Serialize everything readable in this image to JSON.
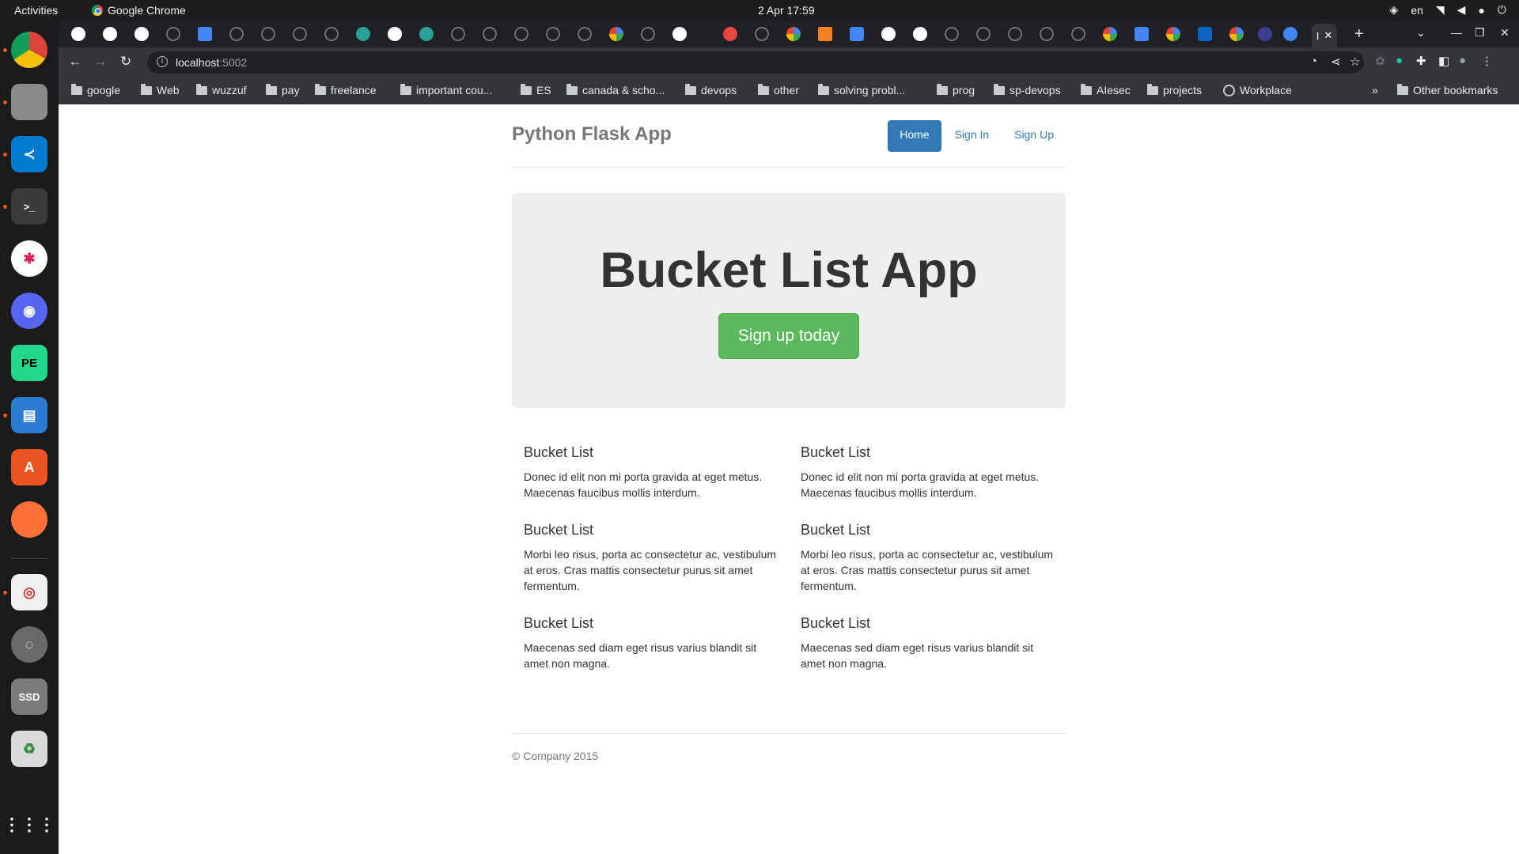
{
  "topbar": {
    "activities": "Activities",
    "app_name": "Google Chrome",
    "clock": "2 Apr  17:59",
    "lang": "en"
  },
  "browser": {
    "active_tab_label": "I",
    "url_host": "localhost",
    "url_port": ":5002"
  },
  "bookmarks": {
    "items": [
      "google",
      "Web",
      "wuzzuf",
      "pay",
      "freelance",
      "important cou...",
      "ES",
      "canada & scho...",
      "devops",
      "other",
      "solving probl...",
      "prog",
      "sp-devops",
      "AIesec",
      "projects",
      "Workplace"
    ],
    "overflow": "»",
    "other": "Other bookmarks"
  },
  "site": {
    "brand": "Python Flask App",
    "nav": [
      "Home",
      "Sign In",
      "Sign Up"
    ]
  },
  "hero": {
    "title": "Bucket List App",
    "button": "Sign up today"
  },
  "marketing": {
    "left": [
      {
        "heading": "Bucket List",
        "text": "Donec id elit non mi porta gravida at eget metus. Maecenas faucibus mollis interdum."
      },
      {
        "heading": "Bucket List",
        "text": "Morbi leo risus, porta ac consectetur ac, vestibulum at eros. Cras mattis consectetur purus sit amet fermentum."
      },
      {
        "heading": "Bucket List",
        "text": "Maecenas sed diam eget risus varius blandit sit amet non magna."
      }
    ],
    "right": [
      {
        "heading": "Bucket List",
        "text": "Donec id elit non mi porta gravida at eget metus. Maecenas faucibus mollis interdum."
      },
      {
        "heading": "Bucket List",
        "text": "Morbi leo risus, porta ac consectetur ac, vestibulum at eros. Cras mattis consectetur purus sit amet fermentum."
      },
      {
        "heading": "Bucket List",
        "text": "Maecenas sed diam eget risus varius blandit sit amet non magna."
      }
    ]
  },
  "footer": {
    "text": "© Company 2015"
  }
}
